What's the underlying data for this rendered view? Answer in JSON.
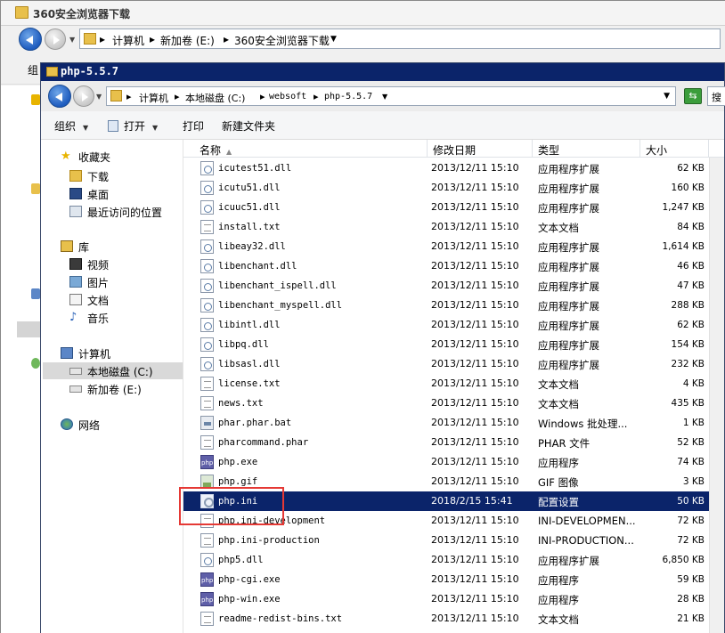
{
  "bg_window": {
    "title": "360安全浏览器下载",
    "breadcrumbs": [
      "计算机",
      "新加卷 (E:)",
      "360安全浏览器下载"
    ],
    "menu_item": "组"
  },
  "fg_window": {
    "title": "php-5.5.7",
    "breadcrumbs": [
      "计算机",
      "本地磁盘 (C:)",
      "websoft",
      "php-5.5.7"
    ],
    "search_placeholder": "搜"
  },
  "toolbar": {
    "organize": "组织",
    "open": "打开",
    "print": "打印",
    "new_folder": "新建文件夹"
  },
  "sidebar": {
    "favorites": "收藏夹",
    "downloads": "下载",
    "desktop": "桌面",
    "recent": "最近访问的位置",
    "libraries": "库",
    "videos": "视频",
    "pictures": "图片",
    "documents": "文档",
    "music": "音乐",
    "computer": "计算机",
    "local_disk": "本地磁盘 (C:)",
    "new_volume": "新加卷 (E:)",
    "network": "网络"
  },
  "columns": {
    "name": "名称",
    "date": "修改日期",
    "type": "类型",
    "size": "大小"
  },
  "files": [
    {
      "name": "icutest51.dll",
      "date": "2013/12/11 15:10",
      "type": "应用程序扩展",
      "size": "62 KB",
      "icon": "dll"
    },
    {
      "name": "icutu51.dll",
      "date": "2013/12/11 15:10",
      "type": "应用程序扩展",
      "size": "160 KB",
      "icon": "dll"
    },
    {
      "name": "icuuc51.dll",
      "date": "2013/12/11 15:10",
      "type": "应用程序扩展",
      "size": "1,247 KB",
      "icon": "dll"
    },
    {
      "name": "install.txt",
      "date": "2013/12/11 15:10",
      "type": "文本文档",
      "size": "84 KB",
      "icon": "txt"
    },
    {
      "name": "libeay32.dll",
      "date": "2013/12/11 15:10",
      "type": "应用程序扩展",
      "size": "1,614 KB",
      "icon": "dll"
    },
    {
      "name": "libenchant.dll",
      "date": "2013/12/11 15:10",
      "type": "应用程序扩展",
      "size": "46 KB",
      "icon": "dll"
    },
    {
      "name": "libenchant_ispell.dll",
      "date": "2013/12/11 15:10",
      "type": "应用程序扩展",
      "size": "47 KB",
      "icon": "dll"
    },
    {
      "name": "libenchant_myspell.dll",
      "date": "2013/12/11 15:10",
      "type": "应用程序扩展",
      "size": "288 KB",
      "icon": "dll"
    },
    {
      "name": "libintl.dll",
      "date": "2013/12/11 15:10",
      "type": "应用程序扩展",
      "size": "62 KB",
      "icon": "dll"
    },
    {
      "name": "libpq.dll",
      "date": "2013/12/11 15:10",
      "type": "应用程序扩展",
      "size": "154 KB",
      "icon": "dll"
    },
    {
      "name": "libsasl.dll",
      "date": "2013/12/11 15:10",
      "type": "应用程序扩展",
      "size": "232 KB",
      "icon": "dll"
    },
    {
      "name": "license.txt",
      "date": "2013/12/11 15:10",
      "type": "文本文档",
      "size": "4 KB",
      "icon": "txt"
    },
    {
      "name": "news.txt",
      "date": "2013/12/11 15:10",
      "type": "文本文档",
      "size": "435 KB",
      "icon": "txt"
    },
    {
      "name": "phar.phar.bat",
      "date": "2013/12/11 15:10",
      "type": "Windows 批处理...",
      "size": "1 KB",
      "icon": "bat"
    },
    {
      "name": "pharcommand.phar",
      "date": "2013/12/11 15:10",
      "type": "PHAR 文件",
      "size": "52 KB",
      "icon": "txt"
    },
    {
      "name": "php.exe",
      "date": "2013/12/11 15:10",
      "type": "应用程序",
      "size": "74 KB",
      "icon": "php"
    },
    {
      "name": "php.gif",
      "date": "2013/12/11 15:10",
      "type": "GIF 图像",
      "size": "3 KB",
      "icon": "gif"
    },
    {
      "name": "php.ini",
      "date": "2018/2/15 15:41",
      "type": "配置设置",
      "size": "50 KB",
      "icon": "ini",
      "selected": true
    },
    {
      "name": "php.ini-development",
      "date": "2013/12/11 15:10",
      "type": "INI-DEVELOPMEN...",
      "size": "72 KB",
      "icon": "txt"
    },
    {
      "name": "php.ini-production",
      "date": "2013/12/11 15:10",
      "type": "INI-PRODUCTION...",
      "size": "72 KB",
      "icon": "txt"
    },
    {
      "name": "php5.dll",
      "date": "2013/12/11 15:10",
      "type": "应用程序扩展",
      "size": "6,850 KB",
      "icon": "dll"
    },
    {
      "name": "php-cgi.exe",
      "date": "2013/12/11 15:10",
      "type": "应用程序",
      "size": "59 KB",
      "icon": "php"
    },
    {
      "name": "php-win.exe",
      "date": "2013/12/11 15:10",
      "type": "应用程序",
      "size": "28 KB",
      "icon": "php"
    },
    {
      "name": "readme-redist-bins.txt",
      "date": "2013/12/11 15:10",
      "type": "文本文档",
      "size": "21 KB",
      "icon": "txt"
    }
  ]
}
